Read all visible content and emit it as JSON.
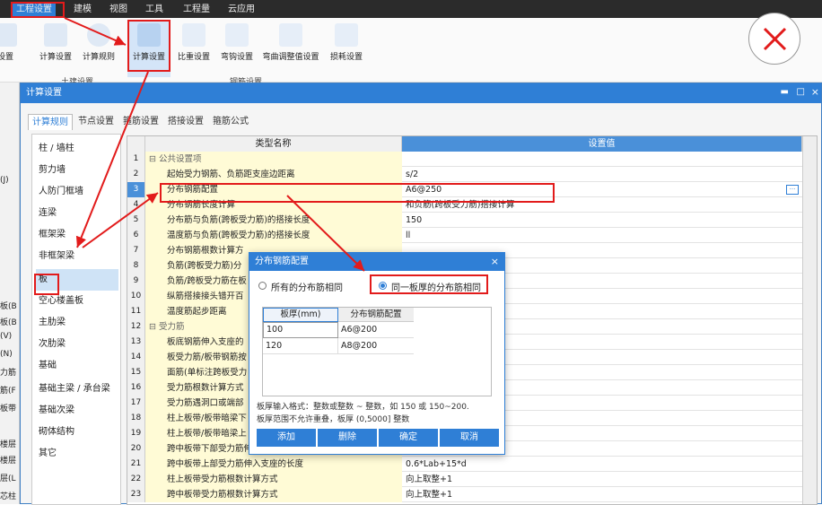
{
  "menubar": {
    "items": [
      "工程设置",
      "建模",
      "视图",
      "工具",
      "工程量",
      "云应用"
    ]
  },
  "ribbon": {
    "buttons": [
      "设置",
      "计算设置",
      "计算规则",
      "计算设置",
      "比重设置",
      "弯钩设置",
      "弯曲调整值设置",
      "损耗设置"
    ],
    "groups": [
      "土建设置",
      "钢筋设置"
    ]
  },
  "left_strip": [
    "(J)",
    "板(B",
    "板(B",
    "(V)",
    "(N)",
    "力筋",
    "筋(F",
    "板带",
    "楼层",
    "楼层",
    "层(L",
    "芯柱"
  ],
  "dialog": {
    "title": "计算设置",
    "tabs": [
      "计算规则",
      "节点设置",
      "箍筋设置",
      "搭接设置",
      "箍筋公式"
    ],
    "categories": [
      "柱 / 墙柱",
      "剪力墙",
      "人防门框墙",
      "连梁",
      "框架梁",
      "非框架梁",
      "板",
      "空心楼盖板",
      "主肋梁",
      "次肋梁",
      "基础",
      "基础主梁 / 承台梁",
      "基础次梁",
      "砌体结构",
      "其它"
    ],
    "grid": {
      "col_name": "类型名称",
      "col_value": "设置值",
      "rows": [
        {
          "n": "1",
          "name": "⊟ 公共设置项",
          "value": "",
          "grp": true
        },
        {
          "n": "2",
          "name": "起始受力钢筋、负筋距支座边距离",
          "value": "s/2"
        },
        {
          "n": "3",
          "name": "分布钢筋配置",
          "value": "A6@250"
        },
        {
          "n": "4",
          "name": "分布钢筋长度计算",
          "value": "和负筋(跨板受力筋)搭接计算"
        },
        {
          "n": "5",
          "name": "分布筋与负筋(跨板受力筋)的搭接长度",
          "value": "150"
        },
        {
          "n": "6",
          "name": "温度筋与负筋(跨板受力筋)的搭接长度",
          "value": "ll"
        },
        {
          "n": "7",
          "name": "分布钢筋根数计算方",
          "value": ""
        },
        {
          "n": "8",
          "name": "负筋(跨板受力筋)分",
          "value": ""
        },
        {
          "n": "9",
          "name": "负筋/跨板受力筋在板",
          "value": ""
        },
        {
          "n": "10",
          "name": "纵筋搭接接头错开百",
          "value": ""
        },
        {
          "n": "11",
          "name": "温度筋起步距离",
          "value": ""
        },
        {
          "n": "12",
          "name": "⊟ 受力筋",
          "value": "",
          "grp": true
        },
        {
          "n": "13",
          "name": "板底钢筋伸入支座的",
          "value": ""
        },
        {
          "n": "14",
          "name": "板受力筋/板带钢筋按",
          "value": ""
        },
        {
          "n": "15",
          "name": "面筋(单标注跨板受力",
          "value": "计算:ha-bhc+15*d"
        },
        {
          "n": "16",
          "name": "受力筋根数计算方式",
          "value": ""
        },
        {
          "n": "17",
          "name": "受力筋遇洞口或端部",
          "value": ""
        },
        {
          "n": "18",
          "name": "柱上板带/板带暗梁下",
          "value": ""
        },
        {
          "n": "19",
          "name": "柱上板带/板带暗梁上",
          "value": ""
        },
        {
          "n": "20",
          "name": "跨中板带下部受力筋伸入支座的长度",
          "value": "max(ha/2,12*d)"
        },
        {
          "n": "21",
          "name": "跨中板带上部受力筋伸入支座的长度",
          "value": "0.6*Lab+15*d"
        },
        {
          "n": "22",
          "name": "柱上板带受力筋根数计算方式",
          "value": "向上取整+1"
        },
        {
          "n": "23",
          "name": "跨中板带受力筋根数计算方式",
          "value": "向上取整+1"
        }
      ]
    }
  },
  "popup": {
    "title": "分布钢筋配置",
    "close": "×",
    "radio1": "所有的分布筋相同",
    "radio2": "同一板厚的分布筋相同",
    "col1": "板厚(mm)",
    "col2": "分布钢筋配置",
    "rows": [
      {
        "t": "100",
        "v": "A6@200"
      },
      {
        "t": "120",
        "v": "A8@200"
      }
    ],
    "hint1": "板厚输入格式：整数或整数 ~ 整数，如 150 或 150~200.",
    "hint2": "板厚范围不允许重叠，板厚 (0,5000] 整数",
    "buttons": [
      "添加",
      "删除",
      "确定",
      "取消"
    ]
  },
  "colors": {
    "accent": "#2f7fd6",
    "highlight": "#e21b1b"
  }
}
